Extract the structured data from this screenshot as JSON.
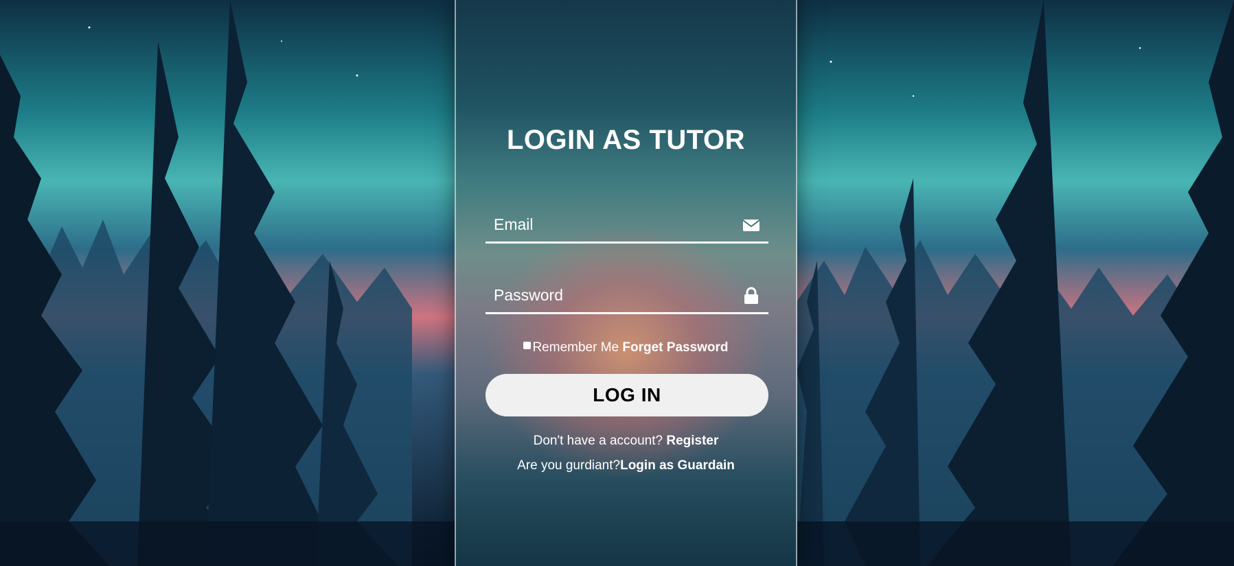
{
  "form": {
    "title": "LOGIN AS TUTOR",
    "email_placeholder": "Email",
    "password_placeholder": "Password",
    "remember_label": "Remember Me",
    "forget_link": "Forget Password",
    "login_button": "LOG IN",
    "register_prompt": "Don't have a account?",
    "register_link": "Register",
    "guardian_prompt": "Are you gurdiant?",
    "guardian_link": "Login as Guardain"
  },
  "icons": {
    "email": "envelope-icon",
    "password": "lock-icon"
  },
  "colors": {
    "text": "#ffffff",
    "button_bg": "#f0f0f0",
    "button_text": "#000000"
  }
}
